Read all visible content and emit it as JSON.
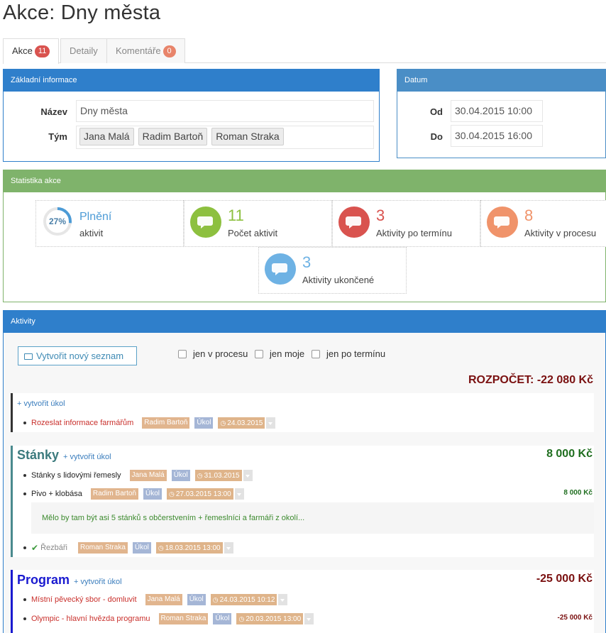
{
  "page": {
    "title": "Akce: Dny města"
  },
  "tabs": [
    {
      "label": "Akce",
      "badge": "11"
    },
    {
      "label": "Detaily"
    },
    {
      "label": "Komentáře",
      "badge": "0"
    }
  ],
  "basic": {
    "header": "Základní informace",
    "name_label": "Název",
    "name_value": "Dny města",
    "team_label": "Tým",
    "team": [
      "Jana Malá",
      "Radim Bartoň",
      "Roman Straka"
    ]
  },
  "date": {
    "header": "Datum",
    "from_label": "Od",
    "from_value": "30.04.2015 10:00",
    "to_label": "Do",
    "to_value": "30.04.2015 16:00"
  },
  "stats": {
    "header": "Statistika akce",
    "fulfillment": {
      "percent": "27%",
      "value": 0.27,
      "title": "Plnění",
      "label": "aktivit"
    },
    "total": {
      "number": "11",
      "label": "Počet aktivit"
    },
    "overdue": {
      "number": "3",
      "label": "Aktivity po termínu"
    },
    "in_progress": {
      "number": "8",
      "label": "Aktivity v procesu"
    },
    "done": {
      "number": "3",
      "label": "Aktivity ukončené"
    }
  },
  "activities": {
    "header": "Aktivity",
    "new_list_label": "Vytvořit nový seznam",
    "filters": [
      "jen v procesu",
      "jen moje",
      "jen po termínu"
    ],
    "budget": "ROZPOČET: -22 080 Kč",
    "create_task": "+ vytvořit úkol",
    "ungrouped": {
      "items": [
        {
          "title": "Rozeslat informace farmářům",
          "person": "Radim Bartoň",
          "type": "Úkol",
          "date": "24.03.2015"
        }
      ]
    },
    "stanky": {
      "title": "Stánky",
      "amount": "8 000 Kč",
      "items": [
        {
          "title": "Stánky s lidovými řemesly",
          "person": "Jana Malá",
          "type": "Úkol",
          "date": "31.03.2015"
        },
        {
          "title": "Pivo + klobása",
          "person": "Radim Bartoň",
          "type": "Úkol",
          "date": "27.03.2015 13:00",
          "amount": "8 000 Kč",
          "note": "Mělo by tam být asi 5 stánků s občerstvením + řemeslníci a farmáři z okolí..."
        },
        {
          "title": "Řezbáři",
          "person": "Roman Straka",
          "type": "Úkol",
          "date": "18.03.2015 13:00"
        }
      ]
    },
    "program": {
      "title": "Program",
      "amount": "-25 000 Kč",
      "items": [
        {
          "title": "Místní pěvecký sbor - domluvit",
          "person": "Jana Malá",
          "type": "Úkol",
          "date": "24.03.2015 10:12"
        },
        {
          "title": "Olympic - hlavní hvězda programu",
          "person": "Roman Straka",
          "type": "Úkol",
          "date": "20.03.2015 13:00",
          "amount": "-25 000 Kč"
        }
      ]
    }
  }
}
